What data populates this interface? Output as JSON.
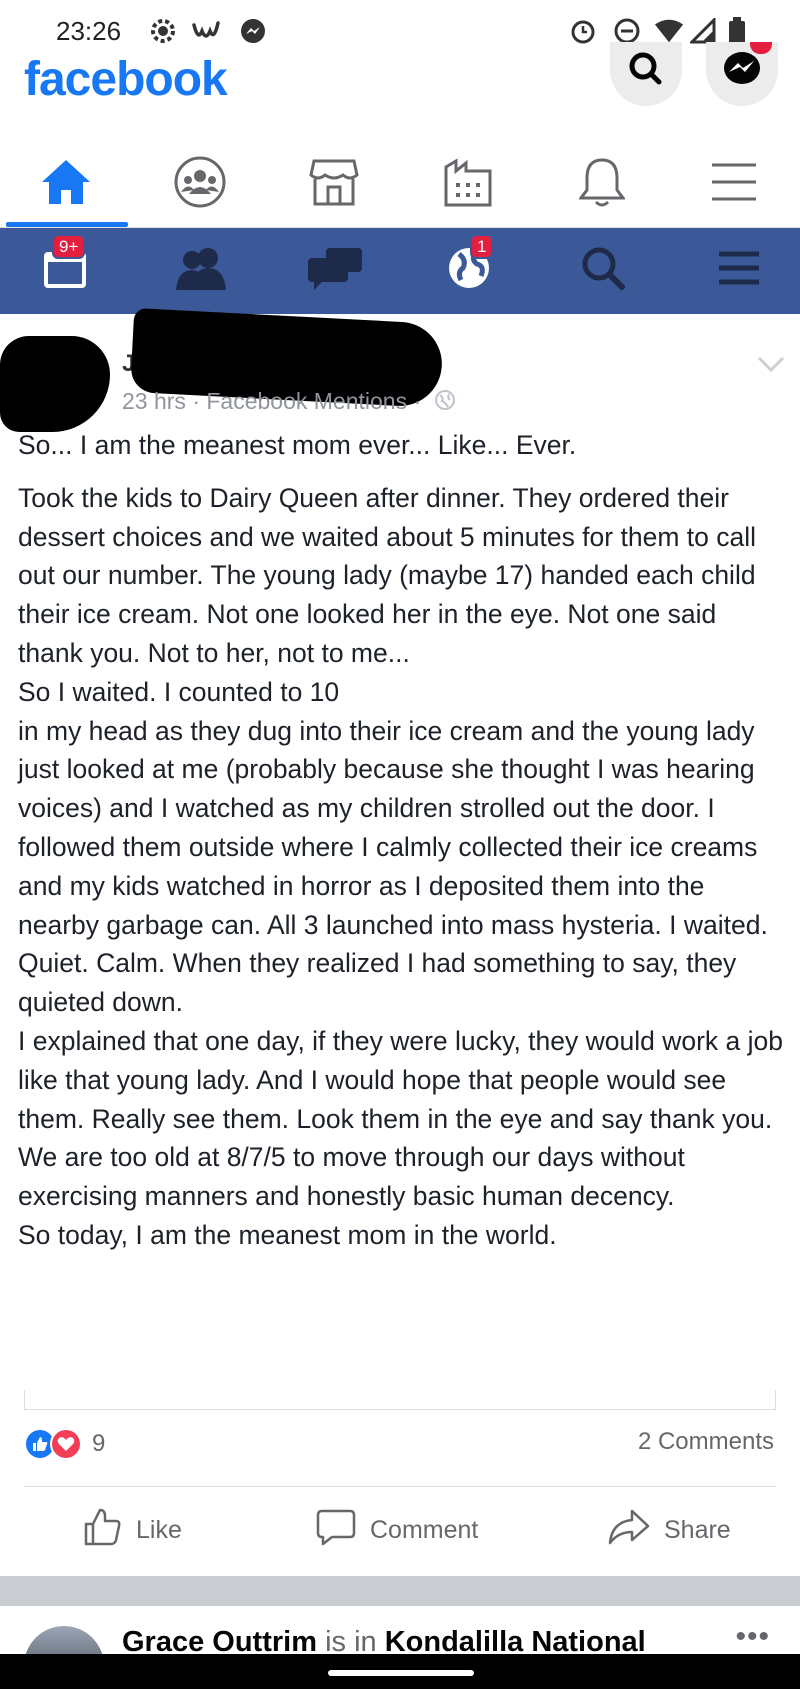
{
  "status_bar": {
    "time": "23:26",
    "left_icons": [
      "settings-icon",
      "w-app-icon",
      "messenger-notif-icon"
    ],
    "right_icons": [
      "alarm-icon",
      "dnd-icon",
      "wifi-icon",
      "signal-icon",
      "battery-icon"
    ]
  },
  "header": {
    "logo": "facebook",
    "buttons": [
      "search-icon",
      "messenger-icon"
    ]
  },
  "tabs": [
    "home",
    "groups",
    "marketplace",
    "pages",
    "notifications",
    "menu"
  ],
  "old_bar": {
    "friend_requests_badge": "9+",
    "notifications_badge": "1",
    "items": [
      "events-icon",
      "friends-icon",
      "messages-icon",
      "globe-icon",
      "search-icon",
      "menu-icon"
    ]
  },
  "post": {
    "author_initial": "J",
    "meta": "23 hrs · Facebook Mentions ·",
    "paragraphs": [
      "So... I am the meanest mom ever... Like... Ever.",
      "Took the kids to Dairy Queen after dinner. They ordered their dessert choices and we waited about 5 minutes for them to call out our number. The young lady (maybe 17) handed each child their ice cream. Not one looked her in the eye. Not one said thank you. Not to her, not to me...\nSo I waited. I counted to 10\nin my head as they dug into their ice cream and the young lady just looked at me (probably because she thought I was hearing voices) and I watched as my children strolled out the door. I followed them outside where I calmly collected their ice creams and my kids watched in horror as I deposited them into the nearby garbage can. All 3 launched into mass hysteria. I waited. Quiet. Calm. When they realized I had something to say, they quieted down.\nI explained that one day, if they were lucky, they would work a job like that young lady. And I would hope that people would see them. Really see them. Look them in the eye and say thank you. We are too old at 8/7/5 to move through our days without exercising manners and honestly basic human decency.\nSo today, I am the meanest mom in the world."
    ],
    "reaction_count": "9",
    "comments_count": "2 Comments",
    "actions": {
      "like": "Like",
      "comment": "Comment",
      "share": "Share"
    }
  },
  "next_post": {
    "author": "Grace Outtrim",
    "connector": "is in",
    "place": "Kondalilla National"
  },
  "colors": {
    "brand_blue": "#1877f2",
    "old_bar_blue": "#3b5998",
    "badge_red": "#e41e3f"
  }
}
